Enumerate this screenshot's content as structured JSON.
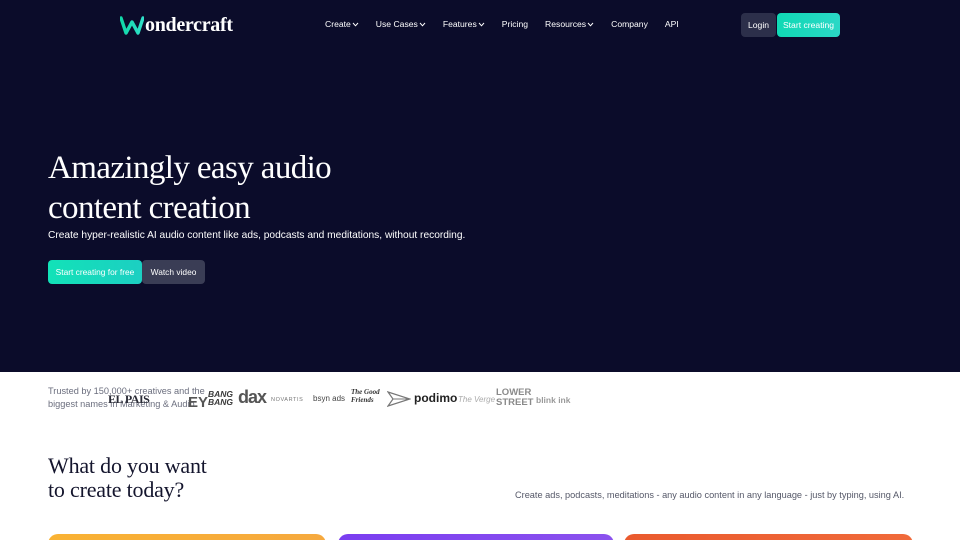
{
  "brand": {
    "name": "ondercraft",
    "logo_letter": "W"
  },
  "nav": {
    "items": [
      {
        "label": "Create",
        "has_dropdown": true
      },
      {
        "label": "Use Cases",
        "has_dropdown": true
      },
      {
        "label": "Features",
        "has_dropdown": true
      },
      {
        "label": "Pricing",
        "has_dropdown": false
      },
      {
        "label": "Resources",
        "has_dropdown": true
      },
      {
        "label": "Company",
        "has_dropdown": false
      },
      {
        "label": "API",
        "has_dropdown": false
      }
    ],
    "login_label": "Login",
    "start_label": "Start creating"
  },
  "hero": {
    "title_line1": "Amazingly easy audio",
    "title_line2": "content creation",
    "subtitle": "Create hyper-realistic AI audio content like ads, podcasts and meditations, without recording.",
    "cta_primary": "Start creating for free",
    "cta_secondary": "Watch video"
  },
  "trusted": {
    "line1": "Trusted by 150,000+ creatives and the",
    "line2": "biggest names in Marketing & Audio",
    "logos": [
      "EL PAIS",
      "EY",
      "BANG BANG",
      "dax",
      "NOVARTIS",
      "bsyn ads",
      "The Good Friends",
      "podimo",
      "The Verge",
      "LOWER STREET",
      "blink ink"
    ]
  },
  "section": {
    "title_line1": "What do you want",
    "title_line2": "to create today?",
    "subtitle": "Create ads, podcasts, meditations - any audio content in any language - just by typing, using AI."
  },
  "colors": {
    "hero_bg": "#0b0c2a",
    "accent": "#10d9b4",
    "card_orange": "#f9b233",
    "card_purple": "#7a3df0",
    "card_red": "#ea5a2e"
  }
}
